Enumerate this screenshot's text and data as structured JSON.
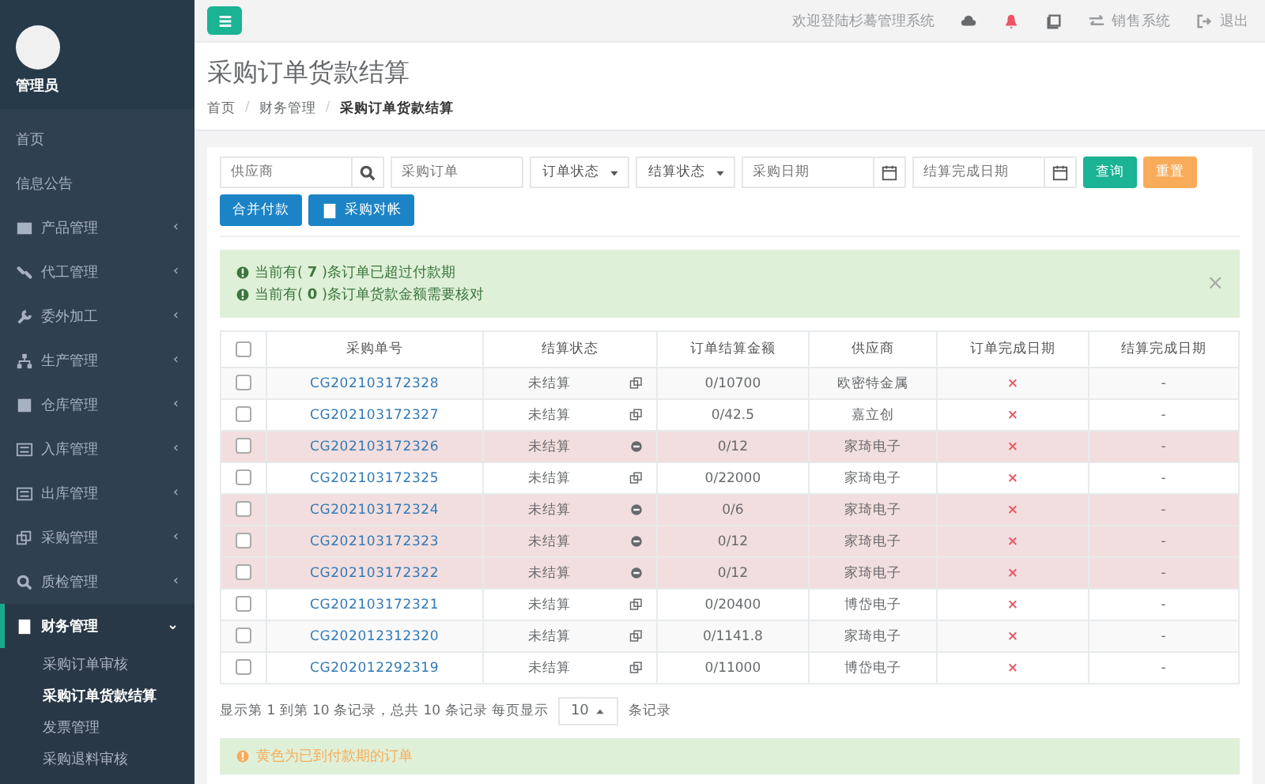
{
  "sidebar": {
    "user": {
      "name": "管理员"
    },
    "items": [
      {
        "label": "首页",
        "expanded": false
      },
      {
        "label": "信息公告",
        "expanded": false
      },
      {
        "label": "产品管理",
        "caret": "‹",
        "expanded": false
      },
      {
        "label": "代工管理",
        "caret": "‹",
        "expanded": false
      },
      {
        "label": "委外加工",
        "caret": "‹",
        "expanded": false
      },
      {
        "label": "生产管理",
        "caret": "‹",
        "expanded": false
      },
      {
        "label": "仓库管理",
        "caret": "‹",
        "expanded": false
      },
      {
        "label": "入库管理",
        "caret": "‹",
        "expanded": false
      },
      {
        "label": "出库管理",
        "caret": "‹",
        "expanded": false
      },
      {
        "label": "采购管理",
        "caret": "‹",
        "expanded": false
      },
      {
        "label": "质检管理",
        "caret": "‹",
        "expanded": false
      },
      {
        "label": "财务管理",
        "caret": "⌄",
        "expanded": true,
        "children": [
          {
            "label": "采购订单审核",
            "selected": false
          },
          {
            "label": "采购订单货款结算",
            "selected": true
          },
          {
            "label": "发票管理",
            "selected": false
          },
          {
            "label": "采购退料审核",
            "selected": false
          }
        ]
      }
    ]
  },
  "topbar": {
    "welcome": "欢迎登陆杉蓦管理系统",
    "links": [
      {
        "label": "销售系统"
      },
      {
        "label": "退出"
      }
    ]
  },
  "page": {
    "title": "采购订单货款结算",
    "breadcrumb": [
      "首页",
      "财务管理",
      "采购订单货款结算"
    ],
    "breadcrumb_separator": "/"
  },
  "filters": {
    "supplier": {
      "placeholder": "供应商"
    },
    "order": {
      "placeholder": "采购订单"
    },
    "order_status": {
      "value": "订单状态"
    },
    "settle_status": {
      "value": "结算状态"
    },
    "purchase_date": {
      "placeholder": "采购日期"
    },
    "settle_date": {
      "placeholder": "结算完成日期"
    },
    "query_button": "查询",
    "reset_button": "重置"
  },
  "actions": [
    {
      "label": "合并付款"
    },
    {
      "label": "采购对帐"
    }
  ],
  "alert": {
    "lines": [
      {
        "before": "当前有(",
        "count": "7",
        "after": ")条订单已超过付款期"
      },
      {
        "before": "当前有(",
        "count": "0",
        "after": ")条订单货款金额需要核对"
      }
    ],
    "close": "×"
  },
  "table": {
    "select_all_checked": false,
    "columns": [
      "采购单号",
      "结算状态",
      "订单结算金额",
      "供应商",
      "订单完成日期",
      "结算完成日期"
    ],
    "rows": [
      {
        "order_no": "CG202103172328",
        "status": "未结算",
        "amount": "0/10700",
        "supplier": "欧密特金属",
        "done": "×",
        "settled": "-",
        "overdue": false,
        "checked": false
      },
      {
        "order_no": "CG202103172327",
        "status": "未结算",
        "amount": "0/42.5",
        "supplier": "嘉立创",
        "done": "×",
        "settled": "-",
        "overdue": false,
        "checked": false
      },
      {
        "order_no": "CG202103172326",
        "status": "未结算",
        "amount": "0/12",
        "supplier": "家琦电子",
        "done": "×",
        "settled": "-",
        "overdue": true,
        "checked": false
      },
      {
        "order_no": "CG202103172325",
        "status": "未结算",
        "amount": "0/22000",
        "supplier": "家琦电子",
        "done": "×",
        "settled": "-",
        "overdue": false,
        "checked": false
      },
      {
        "order_no": "CG202103172324",
        "status": "未结算",
        "amount": "0/6",
        "supplier": "家琦电子",
        "done": "×",
        "settled": "-",
        "overdue": true,
        "checked": false
      },
      {
        "order_no": "CG202103172323",
        "status": "未结算",
        "amount": "0/12",
        "supplier": "家琦电子",
        "done": "×",
        "settled": "-",
        "overdue": true,
        "checked": false
      },
      {
        "order_no": "CG202103172322",
        "status": "未结算",
        "amount": "0/12",
        "supplier": "家琦电子",
        "done": "×",
        "settled": "-",
        "overdue": true,
        "checked": false
      },
      {
        "order_no": "CG202103172321",
        "status": "未结算",
        "amount": "0/20400",
        "supplier": "博岱电子",
        "done": "×",
        "settled": "-",
        "overdue": false,
        "checked": false
      },
      {
        "order_no": "CG202012312320",
        "status": "未结算",
        "amount": "0/1141.8",
        "supplier": "家琦电子",
        "done": "×",
        "settled": "-",
        "overdue": false,
        "checked": false
      },
      {
        "order_no": "CG202012292319",
        "status": "未结算",
        "amount": "0/11000",
        "supplier": "博岱电子",
        "done": "×",
        "settled": "-",
        "overdue": false,
        "checked": false
      }
    ]
  },
  "pagination": {
    "summary": "显示第 1 到第 10 条记录，总共 10 条记录 每页显示",
    "page_size": "10",
    "suffix": "条记录"
  },
  "legend": {
    "text": "黄色为已到付款期的订单"
  }
}
